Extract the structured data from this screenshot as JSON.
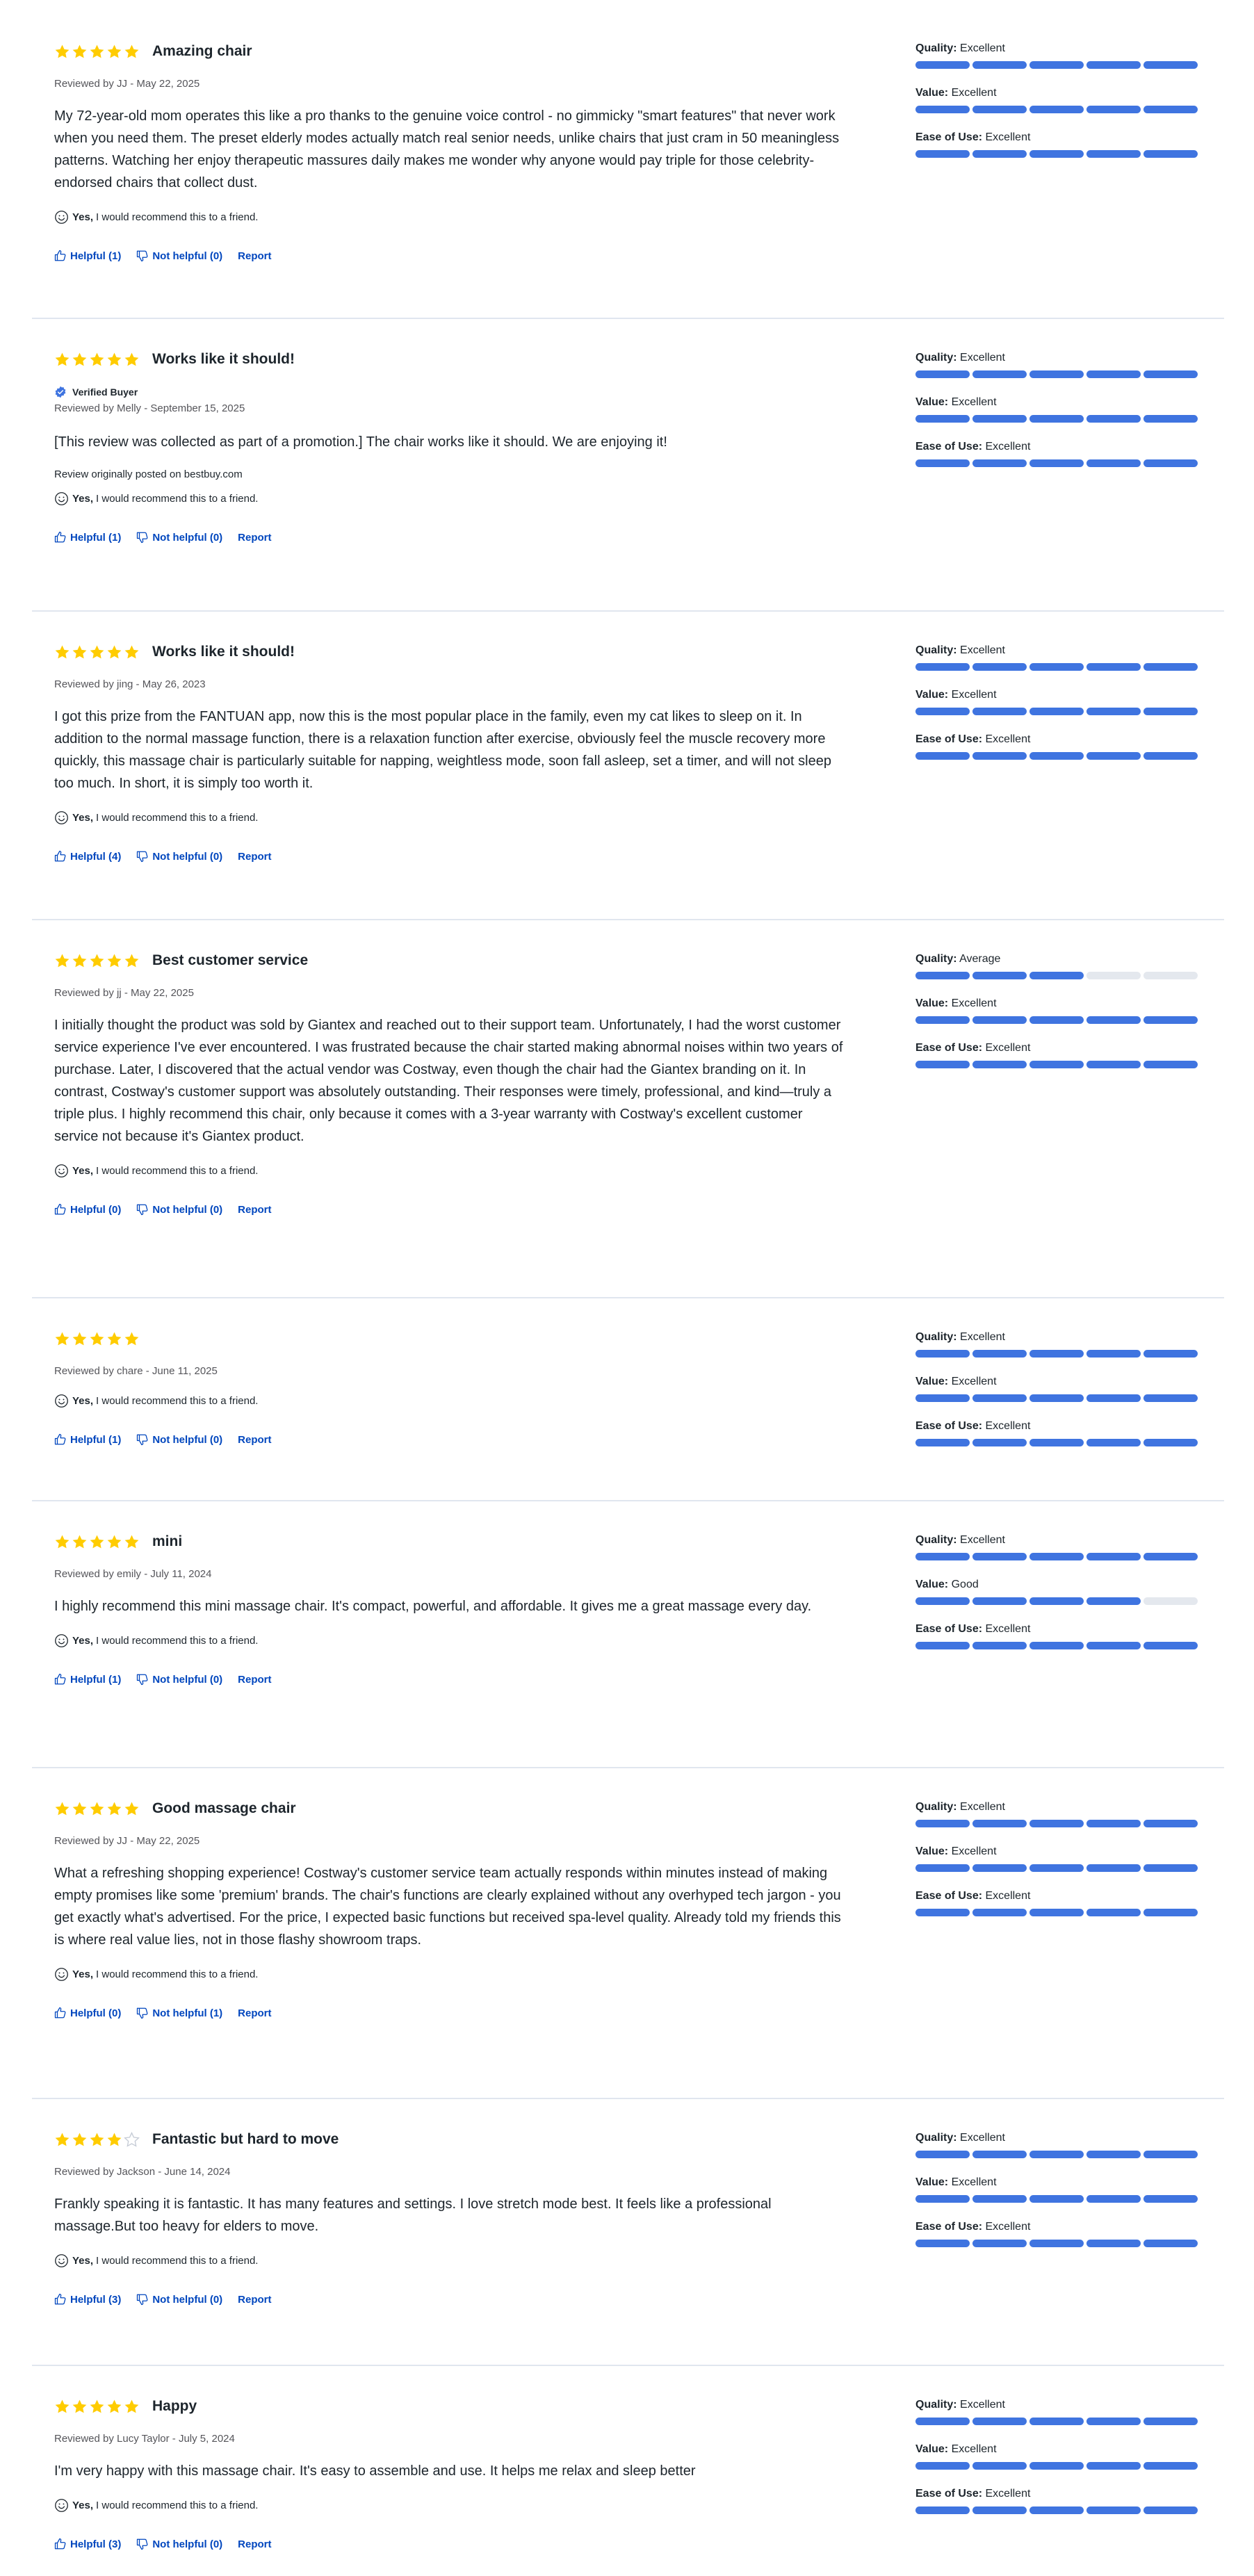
{
  "recommend_yes": "Yes,",
  "recommend_rest": "I would recommend this to a friend.",
  "report_label": "Report",
  "metric_labels": {
    "quality": "Quality:",
    "value": "Value:",
    "ease": "Ease of Use:"
  },
  "colors": {
    "accent": "#0046be",
    "bar_fill": "#3f74e0",
    "bar_track": "#e4e8ee",
    "star": "#ffcc00"
  },
  "reviews": [
    {
      "rating": 5,
      "title": "Amazing chair",
      "byline": "Reviewed by JJ - May 22, 2025",
      "body": "My 72-year-old mom operates this like a pro thanks to the genuine voice control - no gimmicky \"smart features\" that never work when you need them. The preset elderly modes actually match real senior needs, unlike chairs that just cram in 50 meaningless patterns. Watching her enjoy therapeutic massures daily makes me wonder why anyone would pay triple for those celebrity-endorsed chairs that collect dust.",
      "helpful": "Helpful (1)",
      "not_helpful": "Not helpful (0)",
      "quality": {
        "text": "Excellent",
        "level": 5
      },
      "value": {
        "text": "Excellent",
        "level": 5
      },
      "ease": {
        "text": "Excellent",
        "level": 5
      }
    },
    {
      "rating": 5,
      "title": "Works like it should!",
      "verified": "Verified Buyer",
      "byline": "Reviewed by Melly - September 15, 2025",
      "body": "[This review was collected as part of a promotion.] The chair works like it should. We are enjoying it!",
      "origin": "Review originally posted on bestbuy.com",
      "helpful": "Helpful (1)",
      "not_helpful": "Not helpful (0)",
      "quality": {
        "text": "Excellent",
        "level": 5
      },
      "value": {
        "text": "Excellent",
        "level": 5
      },
      "ease": {
        "text": "Excellent",
        "level": 5
      }
    },
    {
      "rating": 5,
      "title": "Works like it should!",
      "byline": "Reviewed by jing - May 26, 2023",
      "body": "I got this prize from the FANTUAN app, now this is the most popular place in the family, even my cat likes to sleep on it. In addition to the normal massage function, there is a relaxation function after exercise, obviously feel the muscle recovery more quickly, this massage chair is particularly suitable for napping, weightless mode, soon fall asleep, set a timer, and will not sleep too much. In short, it is simply too worth it.",
      "helpful": "Helpful (4)",
      "not_helpful": "Not helpful (0)",
      "quality": {
        "text": "Excellent",
        "level": 5
      },
      "value": {
        "text": "Excellent",
        "level": 5
      },
      "ease": {
        "text": "Excellent",
        "level": 5
      }
    },
    {
      "rating": 5,
      "title": "Best customer service",
      "byline": "Reviewed by jj - May 22, 2025",
      "body": "I initially thought the product was sold by Giantex and reached out to their support team. Unfortunately, I had the worst customer service experience I've ever encountered. I was frustrated because the chair started making abnormal noises within two years of purchase. Later, I discovered that the actual vendor was Costway, even though the chair had the Giantex branding on it. In contrast, Costway's customer support was absolutely outstanding. Their responses were timely, professional, and kind—truly a triple plus. I highly recommend this chair, only because it comes with a 3-year warranty with Costway's excellent customer service not because it's Giantex product.",
      "helpful": "Helpful (0)",
      "not_helpful": "Not helpful (0)",
      "quality": {
        "text": "Average",
        "level": 3
      },
      "value": {
        "text": "Excellent",
        "level": 5
      },
      "ease": {
        "text": "Excellent",
        "level": 5
      }
    },
    {
      "rating": 5,
      "title": "",
      "byline": "Reviewed by chare - June 11, 2025",
      "body": "",
      "helpful": "Helpful (1)",
      "not_helpful": "Not helpful (0)",
      "quality": {
        "text": "Excellent",
        "level": 5
      },
      "value": {
        "text": "Excellent",
        "level": 5
      },
      "ease": {
        "text": "Excellent",
        "level": 5
      }
    },
    {
      "rating": 5,
      "title": "mini",
      "byline": "Reviewed by emily - July 11, 2024",
      "body": "I highly recommend this mini massage chair. It's compact, powerful, and affordable. It gives me a great massage every day.",
      "helpful": "Helpful (1)",
      "not_helpful": "Not helpful (0)",
      "quality": {
        "text": "Excellent",
        "level": 5
      },
      "value": {
        "text": "Good",
        "level": 4
      },
      "ease": {
        "text": "Excellent",
        "level": 5
      }
    },
    {
      "rating": 5,
      "title": "Good massage chair",
      "byline": "Reviewed by JJ - May 22, 2025",
      "body": "What a refreshing shopping experience! Costway's customer service team actually responds within minutes instead of making empty promises like some 'premium' brands. The chair's functions are clearly explained without any overhyped tech jargon - you get exactly what's advertised. For the price, I expected basic functions but received spa-level quality. Already told my friends this is where real value lies, not in those flashy showroom traps.",
      "helpful": "Helpful (0)",
      "not_helpful": "Not helpful (1)",
      "quality": {
        "text": "Excellent",
        "level": 5
      },
      "value": {
        "text": "Excellent",
        "level": 5
      },
      "ease": {
        "text": "Excellent",
        "level": 5
      }
    },
    {
      "rating": 4,
      "title": "Fantastic but hard to move",
      "byline": "Reviewed by Jackson - June 14, 2024",
      "body": "Frankly speaking it is fantastic. It has many features and settings. I love stretch mode best. It feels like a professional massage.But too heavy for elders to move.",
      "helpful": "Helpful (3)",
      "not_helpful": "Not helpful (0)",
      "quality": {
        "text": "Excellent",
        "level": 5
      },
      "value": {
        "text": "Excellent",
        "level": 5
      },
      "ease": {
        "text": "Excellent",
        "level": 5
      }
    },
    {
      "rating": 5,
      "title": "Happy",
      "byline": "Reviewed by Lucy Taylor - July 5, 2024",
      "body": "I'm very happy with this massage chair. It's easy to assemble and use. It helps me relax and sleep better",
      "helpful": "Helpful (3)",
      "not_helpful": "Not helpful (0)",
      "quality": {
        "text": "Excellent",
        "level": 5
      },
      "value": {
        "text": "Excellent",
        "level": 5
      },
      "ease": {
        "text": "Excellent",
        "level": 5
      }
    }
  ]
}
